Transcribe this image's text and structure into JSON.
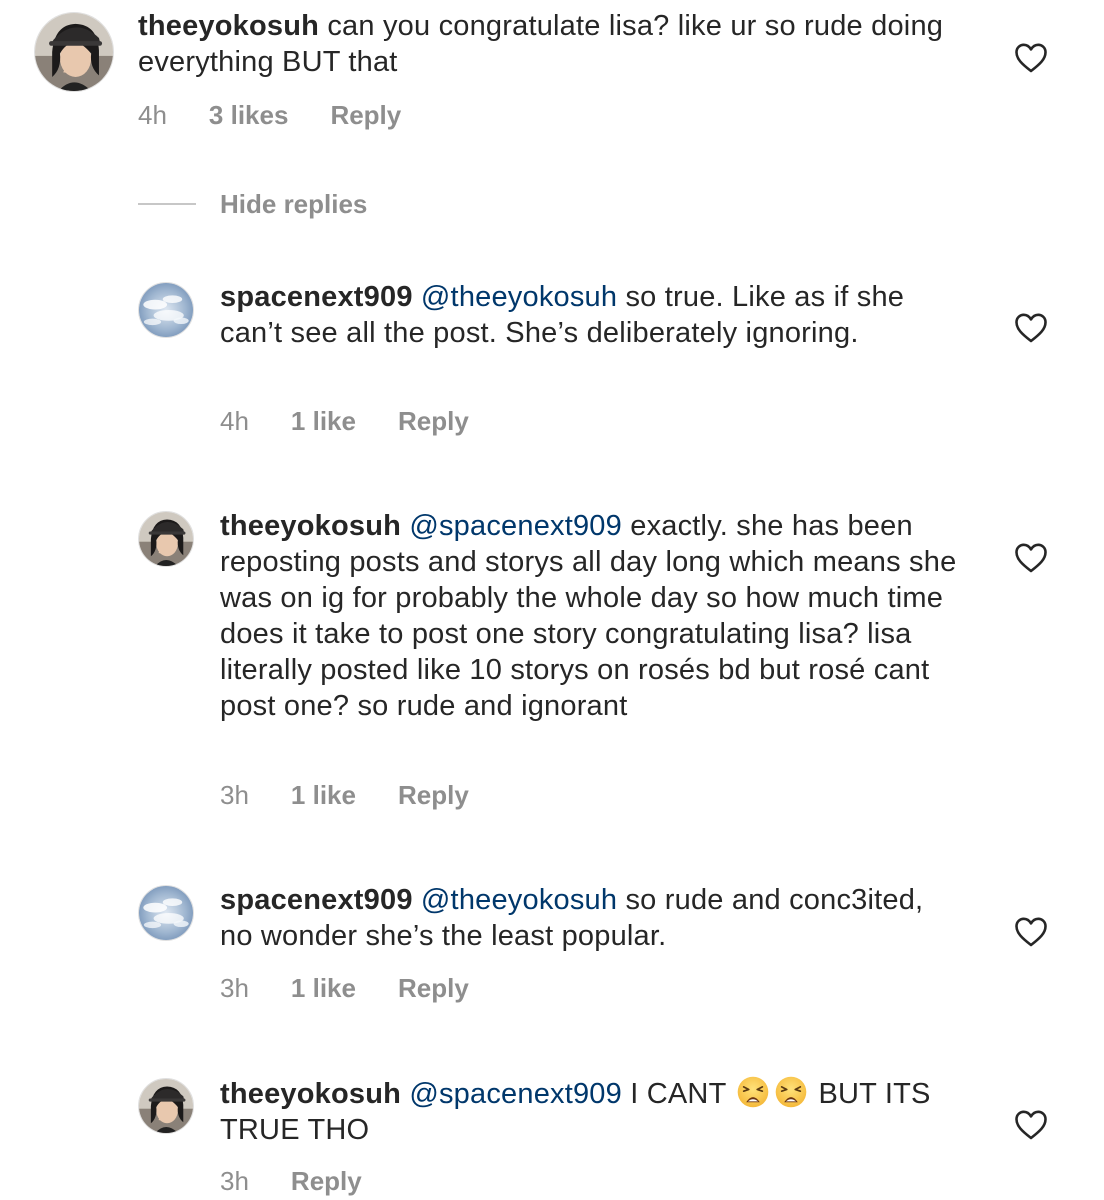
{
  "comments": [
    {
      "username": "theeyokosuh",
      "mention": "",
      "body": "can you congratulate lisa? like ur so rude doing everything BUT that",
      "time": "4h",
      "likes": "3 likes",
      "reply_label": "Reply",
      "avatar_icon": "profile-photo-girl-cap"
    },
    {
      "username": "spacenext909",
      "mention": "@theeyokosuh",
      "body": "so true. Like as if she can’t see all the post. She’s deliberately ignoring.",
      "time": "4h",
      "likes": "1 like",
      "reply_label": "Reply",
      "avatar_icon": "profile-photo-sky-clouds"
    },
    {
      "username": "theeyokosuh",
      "mention": "@spacenext909",
      "body": "exactly. she has been reposting posts and storys all day long which means she was on ig for probably the whole day so how much time does it take to post one story congratulating lisa? lisa literally posted like 10 storys on rosés bd but rosé cant post one? so rude and ignorant",
      "time": "3h",
      "likes": "1 like",
      "reply_label": "Reply",
      "avatar_icon": "profile-photo-girl-cap"
    },
    {
      "username": "spacenext909",
      "mention": "@theeyokosuh",
      "body": "so rude and conc3ited, no wonder she’s the least popular.",
      "time": "3h",
      "likes": "1 like",
      "reply_label": "Reply",
      "avatar_icon": "profile-photo-sky-clouds"
    },
    {
      "username": "theeyokosuh",
      "mention": "@spacenext909",
      "body_before": "I CANT",
      "body_after": "BUT ITS TRUE THO",
      "emoji_icons": [
        "weary-face-emoji",
        "weary-face-emoji"
      ],
      "time": "3h",
      "reply_label": "Reply",
      "avatar_icon": "profile-photo-girl-cap"
    }
  ],
  "hide_replies_label": "Hide replies",
  "colors": {
    "text": "#262626",
    "meta": "#8e8e8e",
    "mention": "#00376b",
    "divider": "#c7c7c7"
  },
  "icons": {
    "like": "heart-outline-icon"
  }
}
